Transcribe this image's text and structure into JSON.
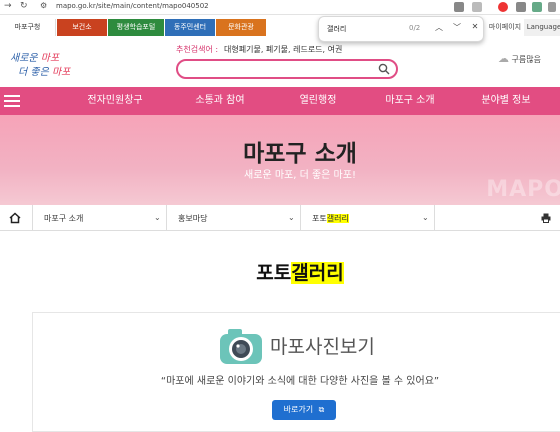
{
  "browser": {
    "url": "mapo.go.kr/site/main/content/mapo040502",
    "find_query": "갤러리",
    "find_count": "0/2",
    "languages_label": "Language",
    "my_page_label": "마이페이지"
  },
  "top_links": [
    {
      "label": "마포구청",
      "color": "#ffffff",
      "text_color": "#333333"
    },
    {
      "label": "보건소",
      "color": "#c9421f",
      "text_color": "#ffffff"
    },
    {
      "label": "평생학습포털",
      "color": "#2e8b3e",
      "text_color": "#ffffff"
    },
    {
      "label": "동주민센터",
      "color": "#2f6fb8",
      "text_color": "#ffffff"
    },
    {
      "label": "문화관광",
      "color": "#d9731e",
      "text_color": "#ffffff"
    }
  ],
  "header": {
    "logo_line1_a": "새로운",
    "logo_line1_b": "마포",
    "logo_line2_a": "더 좋은",
    "logo_line2_b": "마포",
    "recommended_label": "추천검색어 :",
    "recommended_terms": "대형폐기물, 폐기물, 레드로드, 여권",
    "weather_text": "구름많음"
  },
  "main_nav": [
    "전자민원창구",
    "소통과 참여",
    "열린행정",
    "마포구 소개",
    "분야별 정보"
  ],
  "banner": {
    "title": "마포구 소개",
    "subtitle": "새로운 마포, 더 좋은 마포!",
    "deco_text": "MAPO"
  },
  "breadcrumb": {
    "level1": "마포구 소개",
    "level2": "홍보마당",
    "level3_prefix": "포토",
    "level3_highlight": "갤러리"
  },
  "content": {
    "title_prefix": "포토",
    "title_highlight": "갤러리",
    "photo_logo_text": "마포사진보기",
    "quote": "“마포에 새로운 이야기와 소식에 대한 다양한 사진을 볼 수 있어요”",
    "go_button": "바로가기"
  },
  "colors": {
    "accent_pink": "#e24d82",
    "banner_pink": "#f6a3b8",
    "button_blue": "#1f6fd0",
    "highlight": "#ffff00"
  }
}
